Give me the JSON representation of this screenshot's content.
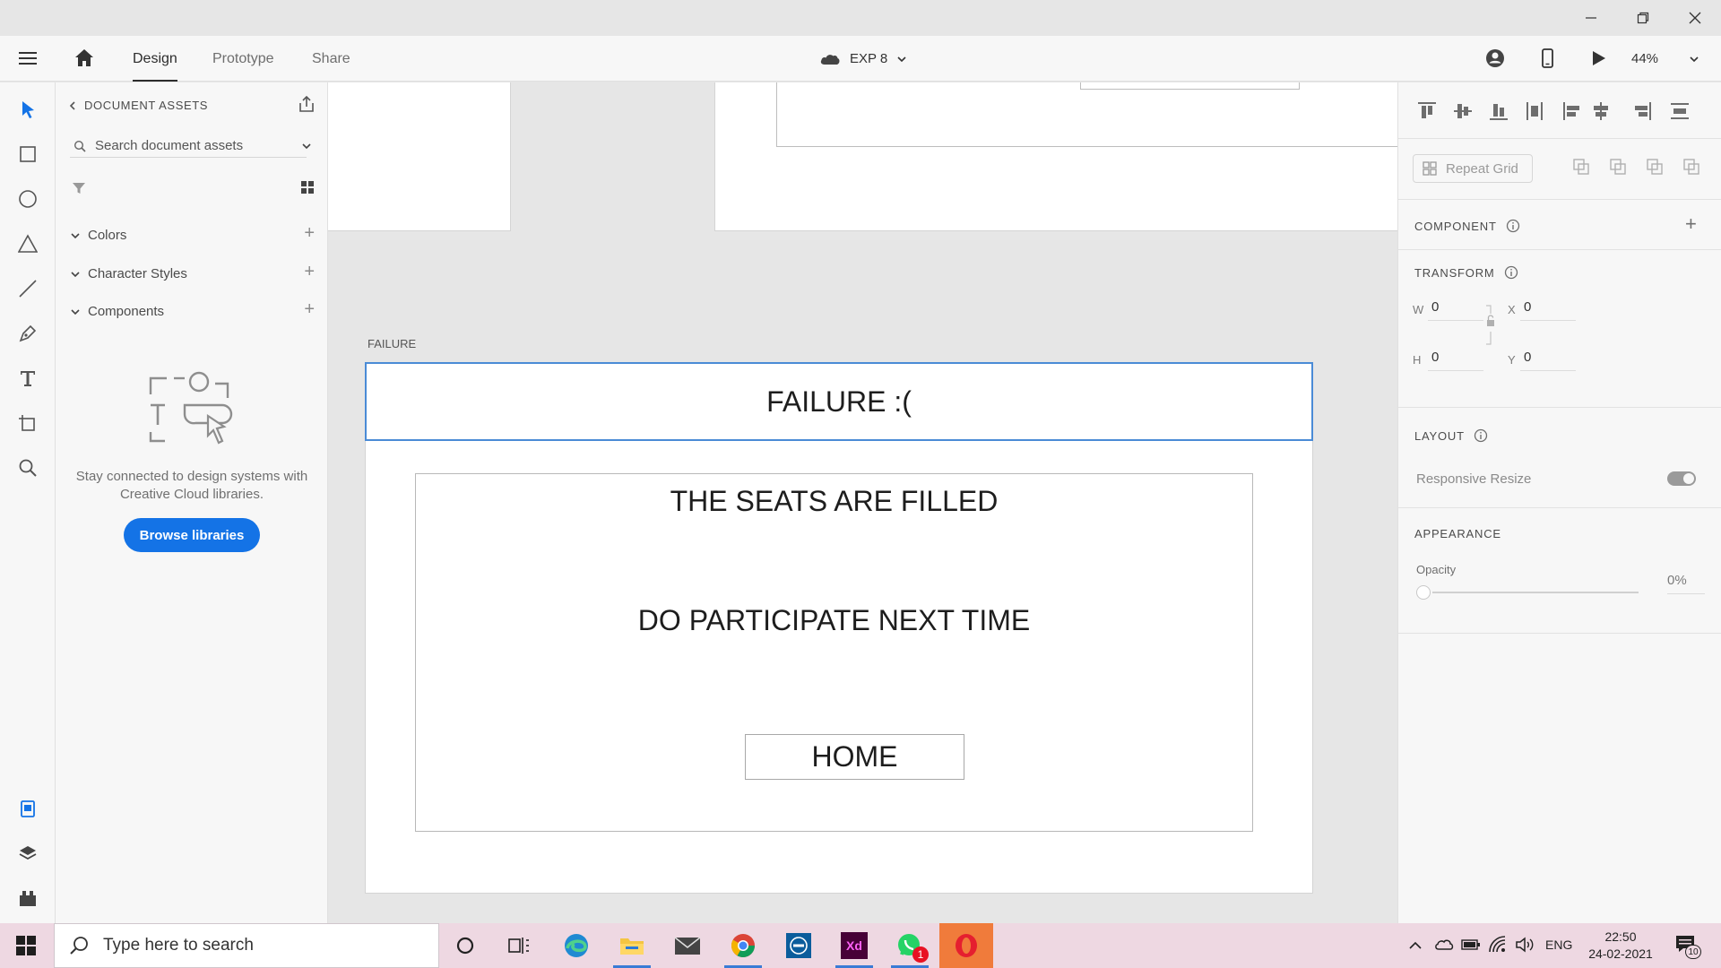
{
  "menubar": {
    "tabs": [
      {
        "label": "Design"
      },
      {
        "label": "Prototype"
      },
      {
        "label": "Share"
      }
    ],
    "document_name": "EXP 8",
    "zoom": "44%"
  },
  "assets": {
    "header": "DOCUMENT ASSETS",
    "search_placeholder": "Search document assets",
    "sections": [
      {
        "label": "Colors"
      },
      {
        "label": "Character Styles"
      },
      {
        "label": "Components"
      }
    ],
    "empty_message": "Stay connected to design systems with Creative Cloud libraries.",
    "browse_button": "Browse libraries"
  },
  "canvas": {
    "artboard_name": "FAILURE",
    "header_text": "FAILURE :(",
    "line1": "THE SEATS ARE FILLED",
    "line2": "DO PARTICIPATE NEXT TIME",
    "home_button": "HOME"
  },
  "properties": {
    "repeat_grid": "Repeat Grid",
    "component_title": "COMPONENT",
    "transform_title": "TRANSFORM",
    "w_label": "W",
    "w_value": "0",
    "x_label": "X",
    "x_value": "0",
    "h_label": "H",
    "h_value": "0",
    "y_label": "Y",
    "y_value": "0",
    "layout_title": "LAYOUT",
    "responsive_resize": "Responsive Resize",
    "appearance_title": "APPEARANCE",
    "opacity_label": "Opacity",
    "opacity_value": "0%"
  },
  "taskbar": {
    "search_placeholder": "Type here to search",
    "language": "ENG",
    "time": "22:50",
    "date": "24-02-2021",
    "notification_count": "10",
    "whatsapp_badge": "1",
    "xd_label": "Xd"
  },
  "colors": {
    "accent": "#1473e6",
    "selection": "#4a8bd6",
    "xd_purple": "#470137",
    "xd_pink": "#ff61f6",
    "opera_red": "#e51f2f"
  }
}
